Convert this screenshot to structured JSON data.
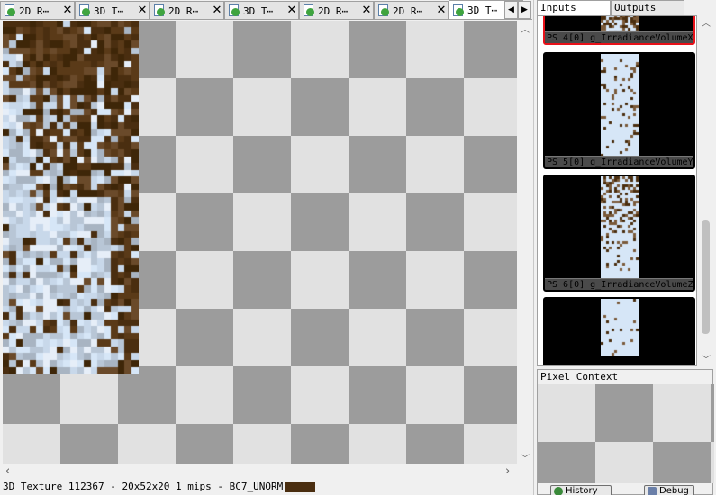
{
  "tabs": [
    {
      "label": "2D R⋯",
      "active": false
    },
    {
      "label": "3D T⋯",
      "active": false
    },
    {
      "label": "2D R⋯",
      "active": false
    },
    {
      "label": "3D T⋯",
      "active": false
    },
    {
      "label": "2D R⋯",
      "active": false
    },
    {
      "label": "2D R⋯",
      "active": false
    },
    {
      "label": "3D T⋯",
      "active": true
    }
  ],
  "tab_close_glyph": "✕",
  "tab_nav": {
    "left": "◀",
    "right": "▶"
  },
  "status": {
    "text": "3D Texture 112367 - 20x52x20 1 mips - BC7_UNORM",
    "swatch_color": "#4a2e10"
  },
  "io_tabs": {
    "inputs": "Inputs",
    "outputs": "Outputs",
    "active": "inputs"
  },
  "thumbnails": [
    {
      "caption": "PS 4[0] g_IrradianceVolumeX",
      "selected": true
    },
    {
      "caption": "PS 5[0] g_IrradianceVolumeY",
      "selected": false
    },
    {
      "caption": "PS 6[0] g_IrradianceVolumeZ",
      "selected": false
    },
    {
      "caption": "",
      "selected": false
    }
  ],
  "pixel_context": {
    "title": "Pixel Context",
    "history_button": "History",
    "debug_button": "Debug"
  },
  "colors": {
    "accent_selected": "#e8121a",
    "texture_dark": "#4a2e10",
    "texture_light": "#d6e6f7"
  }
}
